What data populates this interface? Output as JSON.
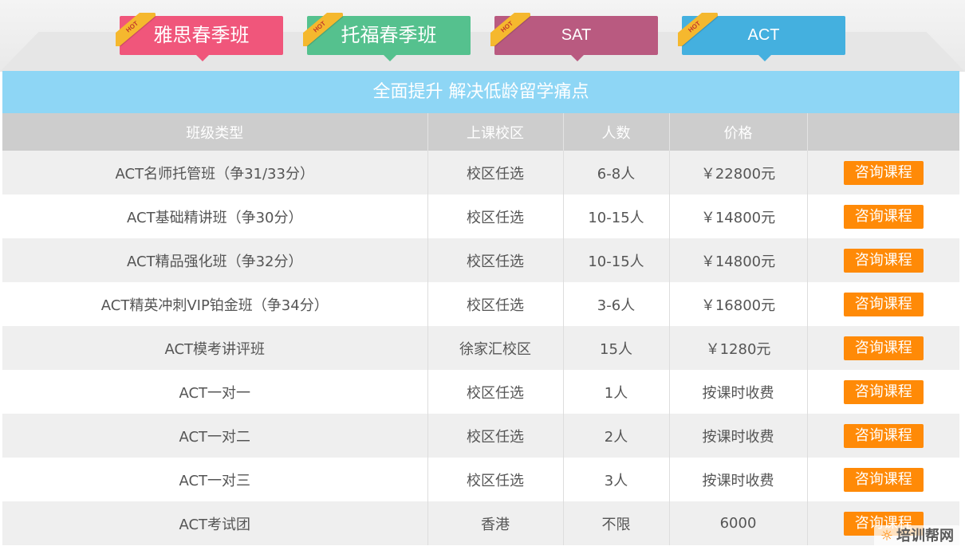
{
  "tabs": [
    {
      "label": "雅思春季班",
      "badge": "HOT"
    },
    {
      "label": "托福春季班",
      "badge": "HOT"
    },
    {
      "label": "SAT",
      "badge": "HOT"
    },
    {
      "label": "ACT",
      "badge": "HOT"
    }
  ],
  "banner": "全面提升 解决低龄留学痛点",
  "table": {
    "headers": [
      "班级类型",
      "上课校区",
      "人数",
      "价格",
      ""
    ],
    "rows": [
      {
        "name": "ACT名师托管班（争31/33分）",
        "campus": "校区任选",
        "size": "6-8人",
        "price": "￥22800元",
        "action": "咨询课程"
      },
      {
        "name": "ACT基础精讲班（争30分）",
        "campus": "校区任选",
        "size": "10-15人",
        "price": "￥14800元",
        "action": "咨询课程"
      },
      {
        "name": "ACT精品强化班（争32分）",
        "campus": "校区任选",
        "size": "10-15人",
        "price": "￥14800元",
        "action": "咨询课程"
      },
      {
        "name": "ACT精英冲刺VIP铂金班（争34分）",
        "campus": "校区任选",
        "size": "3-6人",
        "price": "￥16800元",
        "action": "咨询课程"
      },
      {
        "name": "ACT模考讲评班",
        "campus": "徐家汇校区",
        "size": "15人",
        "price": "￥1280元",
        "action": "咨询课程"
      },
      {
        "name": "ACT一对一",
        "campus": "校区任选",
        "size": "1人",
        "price": "按课时收费",
        "action": "咨询课程"
      },
      {
        "name": "ACT一对二",
        "campus": "校区任选",
        "size": "2人",
        "price": "按课时收费",
        "action": "咨询课程"
      },
      {
        "name": "ACT一对三",
        "campus": "校区任选",
        "size": "3人",
        "price": "按课时收费",
        "action": "咨询课程"
      },
      {
        "name": "ACT考试团",
        "campus": "香港",
        "size": "不限",
        "price": "6000",
        "action": "咨询课程"
      }
    ]
  },
  "watermark": "培训帮网",
  "colors": {
    "tab_ielts": "#f0567b",
    "tab_toefl": "#55c18e",
    "tab_sat": "#b95a80",
    "tab_act": "#44b0df",
    "banner": "#8ed6f5",
    "button": "#ff8a07"
  }
}
